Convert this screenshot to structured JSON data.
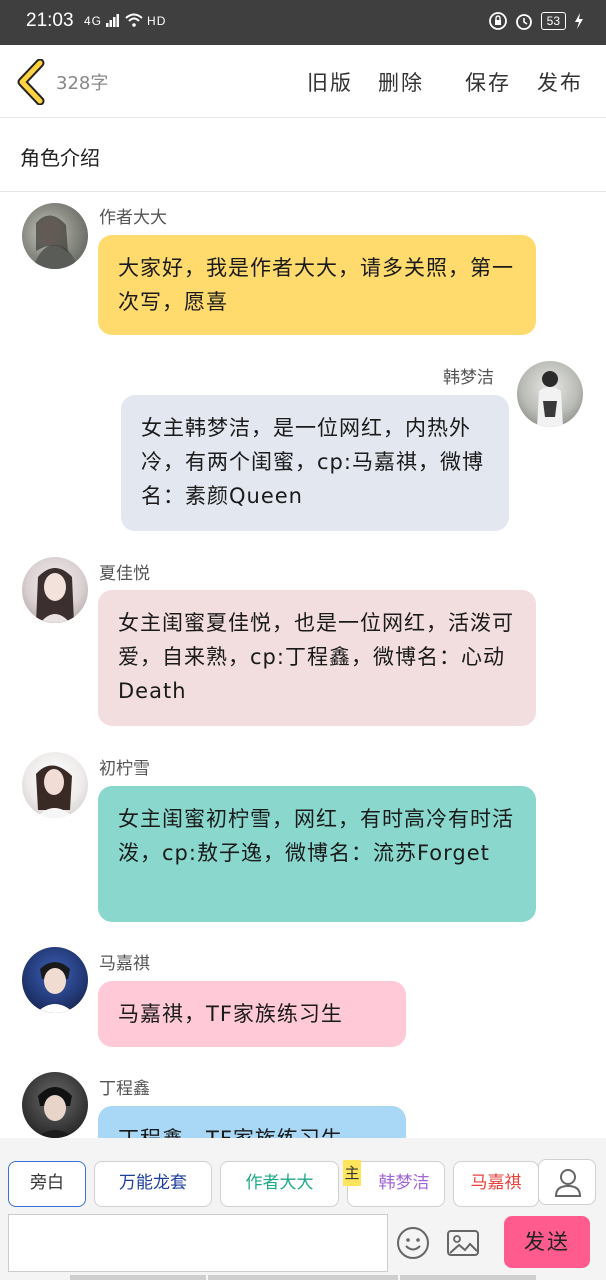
{
  "status_bar": {
    "time": "21:03",
    "network": "4G",
    "hd": "HD",
    "battery": "53"
  },
  "top_bar": {
    "word_count": "328字",
    "actions": [
      "旧版",
      "删除",
      "保存",
      "发布"
    ]
  },
  "section_title": "角色介绍",
  "messages": [
    {
      "sender": "作者大大",
      "text": "大家好，我是作者大大，请多关照，第一次写，愿喜",
      "side": "left",
      "color": "#ffdb6e"
    },
    {
      "sender": "韩梦洁",
      "text": "女主韩梦洁，是一位网红，内热外冷，有两个闺蜜，cp:马嘉祺，微博名：素颜Queen",
      "side": "right",
      "color": "#e3e7ef"
    },
    {
      "sender": "夏佳悦",
      "text": "女主闺蜜夏佳悦，也是一位网红，活泼可爱，自来熟，cp:丁程鑫，微博名：心动Death",
      "side": "left",
      "color": "#f2dede"
    },
    {
      "sender": "初柠雪",
      "text": "女主闺蜜初柠雪，网红，有时高冷有时活泼，cp:敖子逸，微博名：流苏Forget",
      "side": "left",
      "color": "#8ad8cd"
    },
    {
      "sender": "马嘉祺",
      "text": "马嘉祺，TF家族练习生",
      "side": "left",
      "color": "#ffc9d7"
    },
    {
      "sender": "丁程鑫",
      "text": "丁程鑫，TF家族练习生",
      "side": "left",
      "color": "#a8d8f5"
    }
  ],
  "tabs": [
    {
      "label": "旁白",
      "color": "#333333",
      "active": true
    },
    {
      "label": "万能龙套",
      "color": "#1d3f9e"
    },
    {
      "label": "作者大大",
      "color": "#1fa98a"
    },
    {
      "label": "韩梦洁",
      "color": "#a366d8"
    },
    {
      "label": "马嘉祺",
      "color": "#e8413a"
    }
  ],
  "main_badge": "主",
  "input": {
    "value": "",
    "placeholder": ""
  },
  "send_label": "发送",
  "icons": {
    "back": "chevron-left-icon",
    "person": "person-icon",
    "emoji": "smiley-icon",
    "image": "image-icon"
  },
  "colors": {
    "accent": "#ffd23f",
    "send": "#ff5b8f",
    "tab_active_border": "#3a6fd8"
  }
}
